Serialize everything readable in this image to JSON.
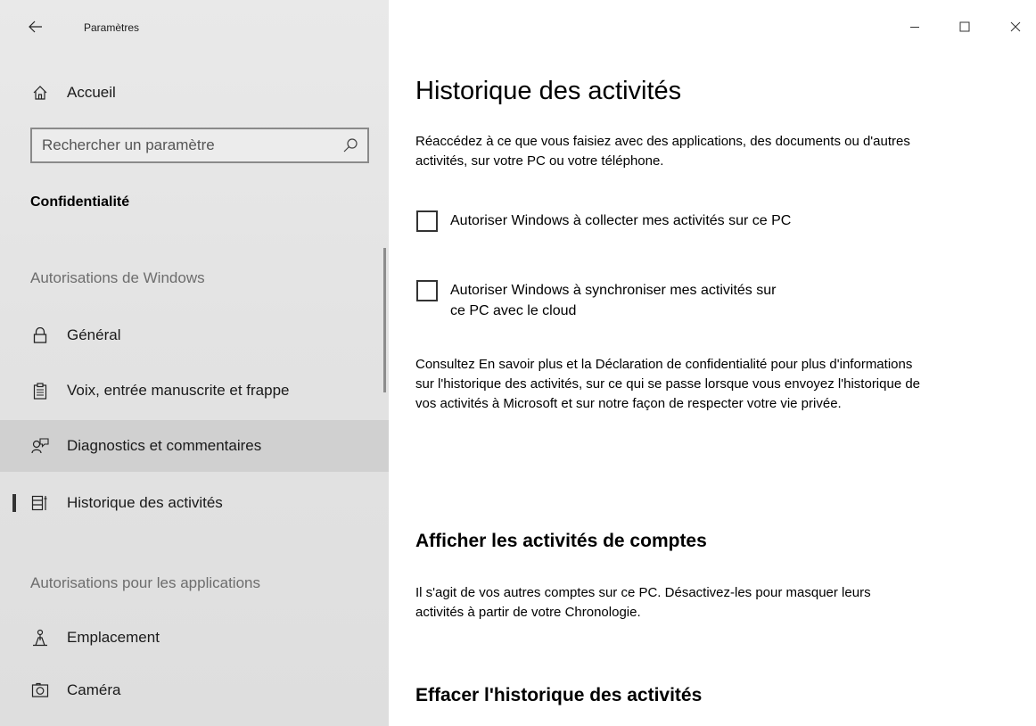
{
  "app": {
    "title": "Paramètres"
  },
  "sidebar": {
    "home_label": "Accueil",
    "search": {
      "placeholder": "Rechercher un paramètre"
    },
    "section_title": "Confidentialité",
    "group_windows": "Autorisations de Windows",
    "group_apps": "Autorisations pour les applications",
    "items": [
      {
        "label": "Général",
        "icon": "lock-icon"
      },
      {
        "label": "Voix, entrée manuscrite et frappe",
        "icon": "clipboard-icon"
      },
      {
        "label": "Diagnostics et commentaires",
        "icon": "feedback-person-icon"
      },
      {
        "label": "Historique des activités",
        "icon": "timeline-icon"
      },
      {
        "label": "Emplacement",
        "icon": "location-person-icon"
      },
      {
        "label": "Caméra",
        "icon": "camera-icon"
      }
    ]
  },
  "main": {
    "title": "Historique des activités",
    "intro": "Réaccédez à ce que vous faisiez avec des applications, des documents ou d'autres activités, sur votre PC ou votre téléphone.",
    "checkboxes": [
      {
        "label": "Autoriser Windows à collecter mes activités sur ce PC",
        "checked": false
      },
      {
        "label": "Autoriser Windows à synchroniser mes activités sur ce PC avec le cloud",
        "checked": false
      }
    ],
    "info": "Consultez En savoir plus et la Déclaration de confidentialité pour plus d'informations sur l'historique des activités, sur ce qui se passe lorsque vous envoyez l'historique de vos activités à Microsoft et sur notre façon de respecter votre vie privée.",
    "accounts_heading": "Afficher les activités de comptes",
    "accounts_text": "Il s'agit de vos autres comptes sur ce PC. Désactivez-les pour masquer leurs activités à partir de votre Chronologie.",
    "clear_heading": "Effacer l'historique des activités"
  },
  "colors": {
    "sidebar_bg": "#e5e5e5",
    "hover_bg": "#d0d0d0",
    "selection_bar": "#333333",
    "group_label": "#6d6d6d"
  }
}
